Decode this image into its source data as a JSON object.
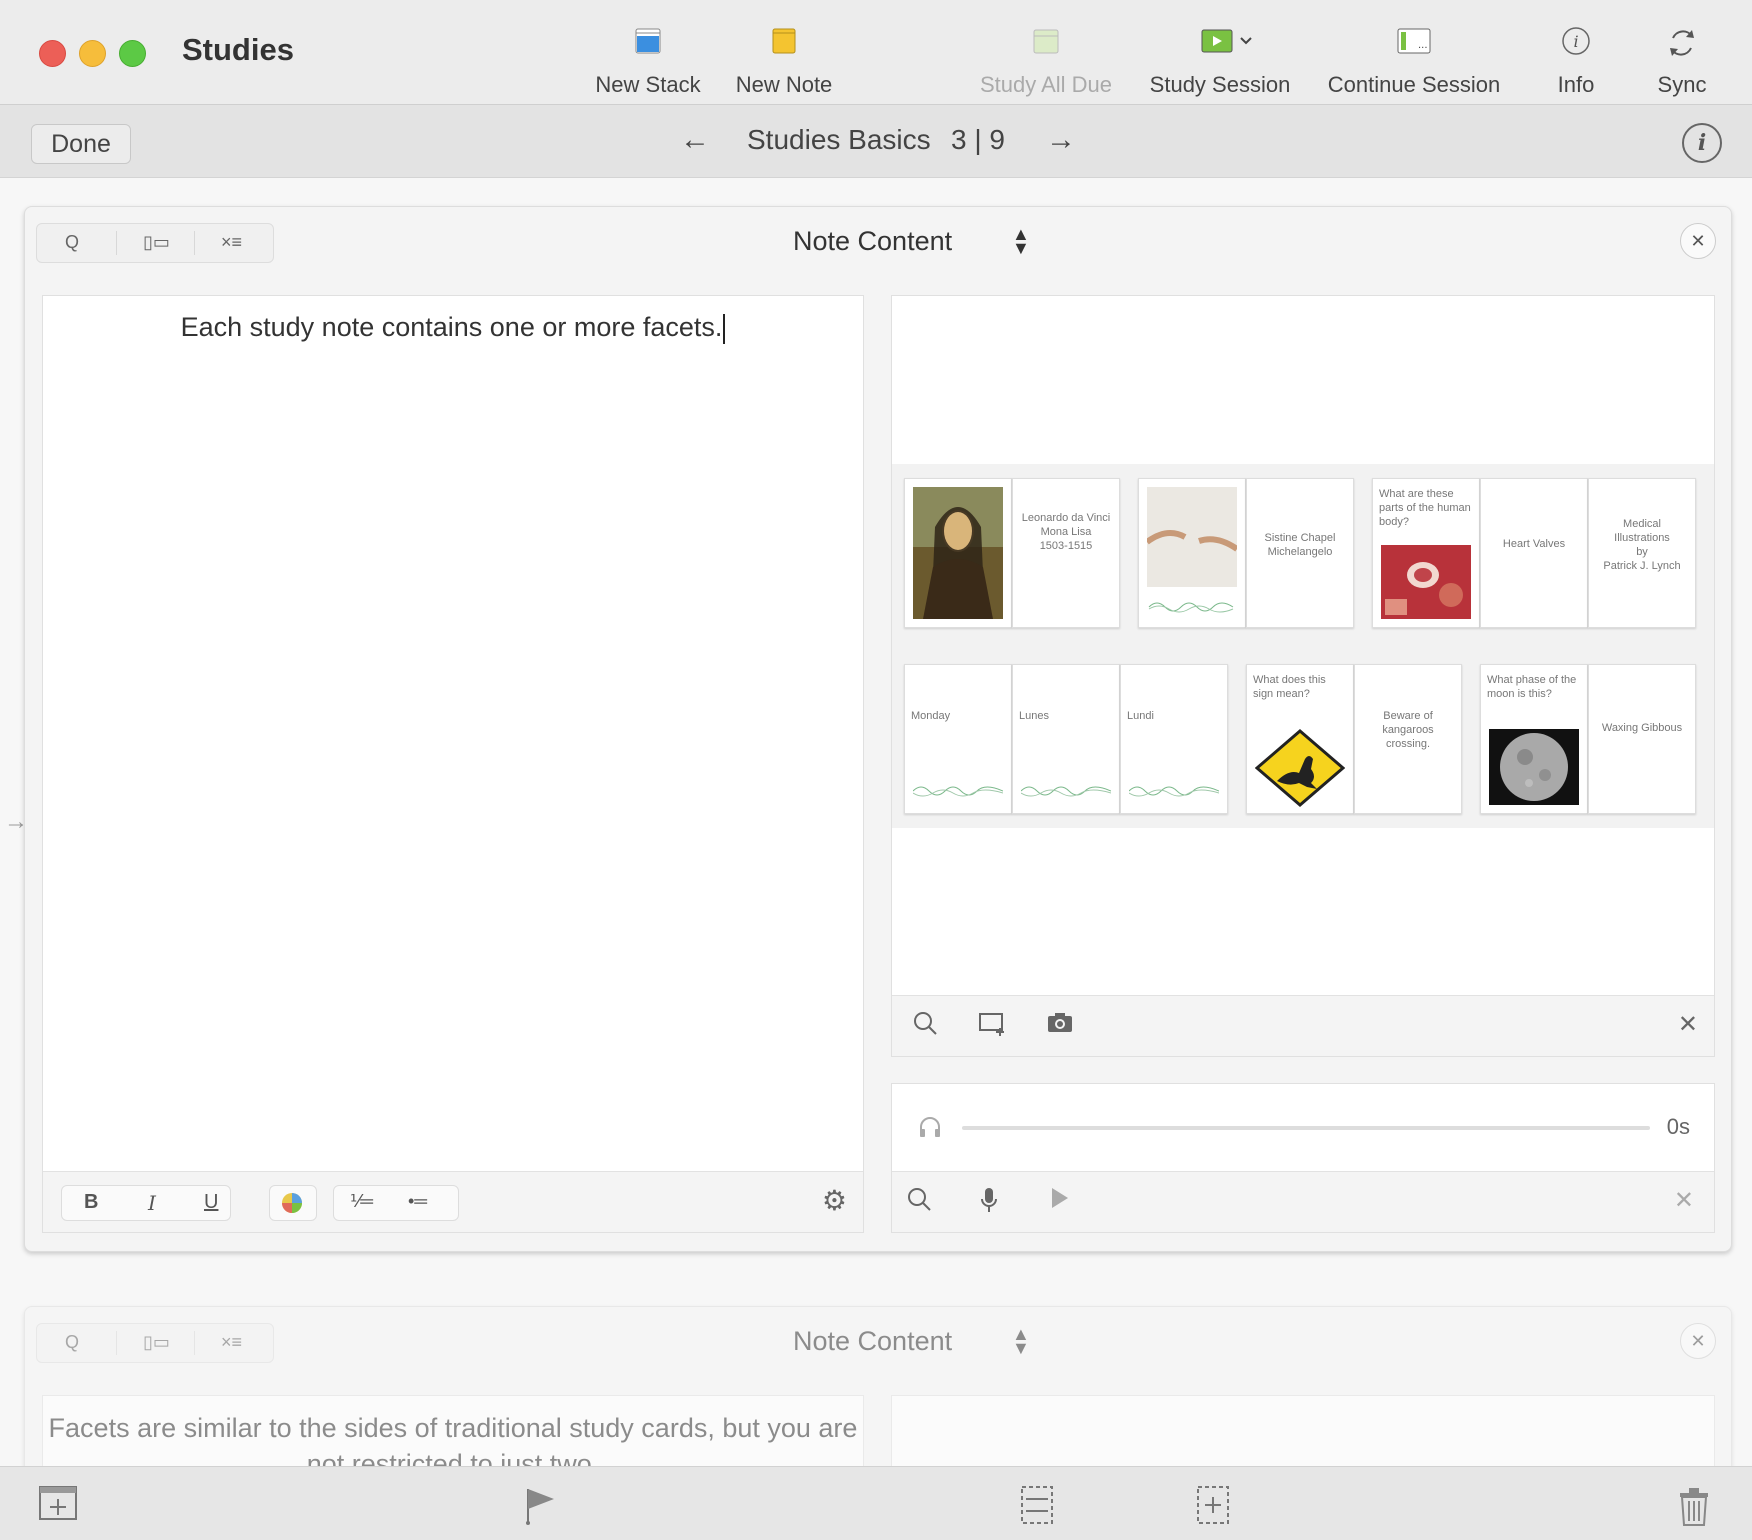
{
  "window": {
    "title": "Studies"
  },
  "toolbar": {
    "new_stack": "New Stack",
    "new_note": "New Note",
    "study_all_due": "Study All Due",
    "study_session": "Study Session",
    "continue_session": "Continue Session",
    "info": "Info",
    "sync": "Sync"
  },
  "navbar": {
    "done": "Done",
    "prev_arrow": "←",
    "next_arrow": "→",
    "stack_title": "Studies Basics",
    "position": "3 | 9",
    "info_icon": "i"
  },
  "notes": [
    {
      "header": {
        "title": "Note Content"
      },
      "text": "Each study note contains one or more facets.",
      "format_bar": {
        "bold": "B",
        "italic": "I",
        "underline": "U"
      },
      "flashcards": [
        {
          "text": "",
          "image": "mona-lisa"
        },
        {
          "text": "Leonardo da Vinci\nMona Lisa\n1503-1515"
        },
        {
          "text": "",
          "image": "creation-of-adam"
        },
        {
          "text": "Sistine Chapel\nMichelangelo"
        },
        {
          "text": "What are these parts of the human body?",
          "image": "heart-valves"
        },
        {
          "text": "Heart Valves"
        },
        {
          "text": "Medical Illustrations\nby\nPatrick J. Lynch"
        },
        {
          "text": "Monday",
          "image": "waveform"
        },
        {
          "text": "Lunes",
          "image": "waveform"
        },
        {
          "text": "Lundi",
          "image": "waveform"
        },
        {
          "text": "What does this sign mean?",
          "image": "kangaroo-sign"
        },
        {
          "text": "Beware of kangaroos crossing."
        },
        {
          "text": "What phase of the moon is this?",
          "image": "moon"
        },
        {
          "text": "Waxing Gibbous"
        }
      ],
      "audio": {
        "time": "0s",
        "progress": 0
      }
    },
    {
      "header": {
        "title": "Note Content"
      },
      "text": "Facets are similar to the sides of traditional study cards, but you are not restricted to just two."
    }
  ],
  "colors": {
    "accent_blue": "#3b8fe0",
    "note_yellow": "#f4c430",
    "session_green": "#7ac142"
  }
}
